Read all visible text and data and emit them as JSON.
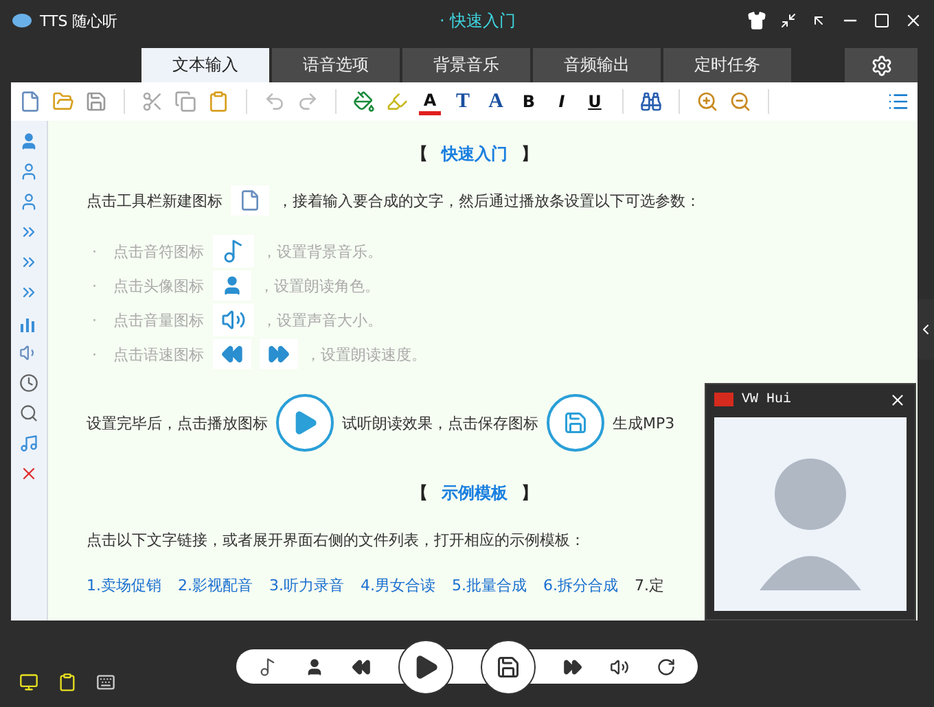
{
  "window": {
    "title": "TTS 随心听",
    "subtitle": "· 快速入门"
  },
  "tabs": [
    {
      "label": "文本输入",
      "selected": true
    },
    {
      "label": "语音选项",
      "selected": false
    },
    {
      "label": "背景音乐",
      "selected": false
    },
    {
      "label": "音频输出",
      "selected": false
    },
    {
      "label": "定时任务",
      "selected": false
    }
  ],
  "toolbar": {
    "format_buttons": [
      {
        "kind": "fontcolor",
        "label": "A"
      },
      {
        "kind": "serif",
        "label": "T"
      },
      {
        "kind": "serif",
        "label": "A"
      },
      {
        "kind": "bold",
        "label": "B"
      },
      {
        "kind": "italic",
        "label": "I"
      },
      {
        "kind": "underline",
        "label": "U"
      }
    ]
  },
  "quick_start": {
    "heading": {
      "open": "【",
      "title": "快速入门",
      "close": "】"
    },
    "intro_before": "点击工具栏新建图标",
    "intro_after": "，接着输入要合成的文字，然后通过播放条设置以下可选参数：",
    "bullets": [
      {
        "kind": "music",
        "marker": "·",
        "before": "点击音符图标",
        "after": "，设置背景音乐。"
      },
      {
        "kind": "voice",
        "marker": "·",
        "before": "点击头像图标",
        "after": "，设置朗读角色。"
      },
      {
        "kind": "volume",
        "marker": "·",
        "before": "点击音量图标",
        "after": "，设置声音大小。"
      },
      {
        "kind": "speed",
        "marker": "·",
        "before": "点击语速图标",
        "after": "，设置朗读速度。"
      }
    ],
    "play_before": "设置完毕后，点击播放图标",
    "play_middle": "试听朗读效果，点击保存图标",
    "play_after": "生成MP3"
  },
  "examples": {
    "heading": {
      "open": "【",
      "title": "示例模板",
      "close": "】"
    },
    "intro": "点击以下文字链接，或者展开界面右侧的文件列表，打开相应的示例模板：",
    "links": [
      {
        "kind": "link",
        "label": "1.卖场促销"
      },
      {
        "kind": "link",
        "label": "2.影视配音"
      },
      {
        "kind": "link",
        "label": "3.听力录音"
      },
      {
        "kind": "link",
        "label": "4.男女合读"
      },
      {
        "kind": "link",
        "label": "5.批量合成"
      },
      {
        "kind": "link",
        "label": "6.拆分合成"
      },
      {
        "kind": "text",
        "label": "7.定"
      }
    ]
  },
  "voice_panel": {
    "name": "VW Hui"
  }
}
